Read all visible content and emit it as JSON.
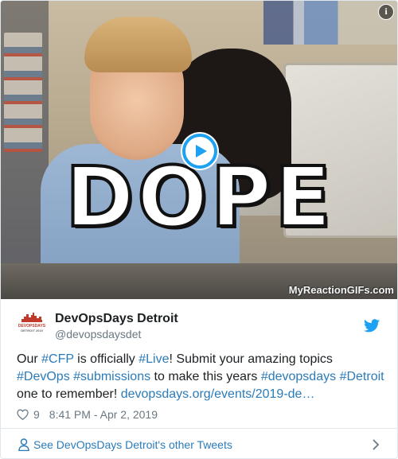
{
  "media": {
    "caption": "DOPE",
    "watermark": "MyReactionGIFs.com",
    "info_icon": "i"
  },
  "author": {
    "name": "DevOpsDays Detroit",
    "handle": "@devopsdaysdet",
    "avatar_text": "DEVOPSDAYS",
    "avatar_subtext": "DETROIT 2019"
  },
  "tweet": {
    "segments": [
      {
        "text": "Our ",
        "link": false
      },
      {
        "text": "#CFP",
        "link": true
      },
      {
        "text": " is officially ",
        "link": false
      },
      {
        "text": "#Live",
        "link": true
      },
      {
        "text": "! Submit your amazing topics ",
        "link": false
      },
      {
        "text": "#DevOps",
        "link": true
      },
      {
        "text": " ",
        "link": false
      },
      {
        "text": "#submissions",
        "link": true
      },
      {
        "text": " to make this years ",
        "link": false
      },
      {
        "text": "#devopsdays",
        "link": true
      },
      {
        "text": " ",
        "link": false
      },
      {
        "text": "#Detroit",
        "link": true
      },
      {
        "text": " one to remember! ",
        "link": false
      },
      {
        "text": "devopsdays.org/events/2019-de…",
        "link": true
      }
    ],
    "likes": "9",
    "timestamp": "8:41 PM - Apr 2, 2019"
  },
  "footer": {
    "label": "See DevOpsDays Detroit's other Tweets"
  },
  "colors": {
    "link": "#2b7bb9",
    "twitter_blue": "#1da1f2",
    "muted": "#697882",
    "brand_red": "#c0392b"
  },
  "icons": [
    "info-icon",
    "play-icon",
    "twitter-bird-icon",
    "heart-icon",
    "person-icon",
    "chevron-right-icon"
  ]
}
